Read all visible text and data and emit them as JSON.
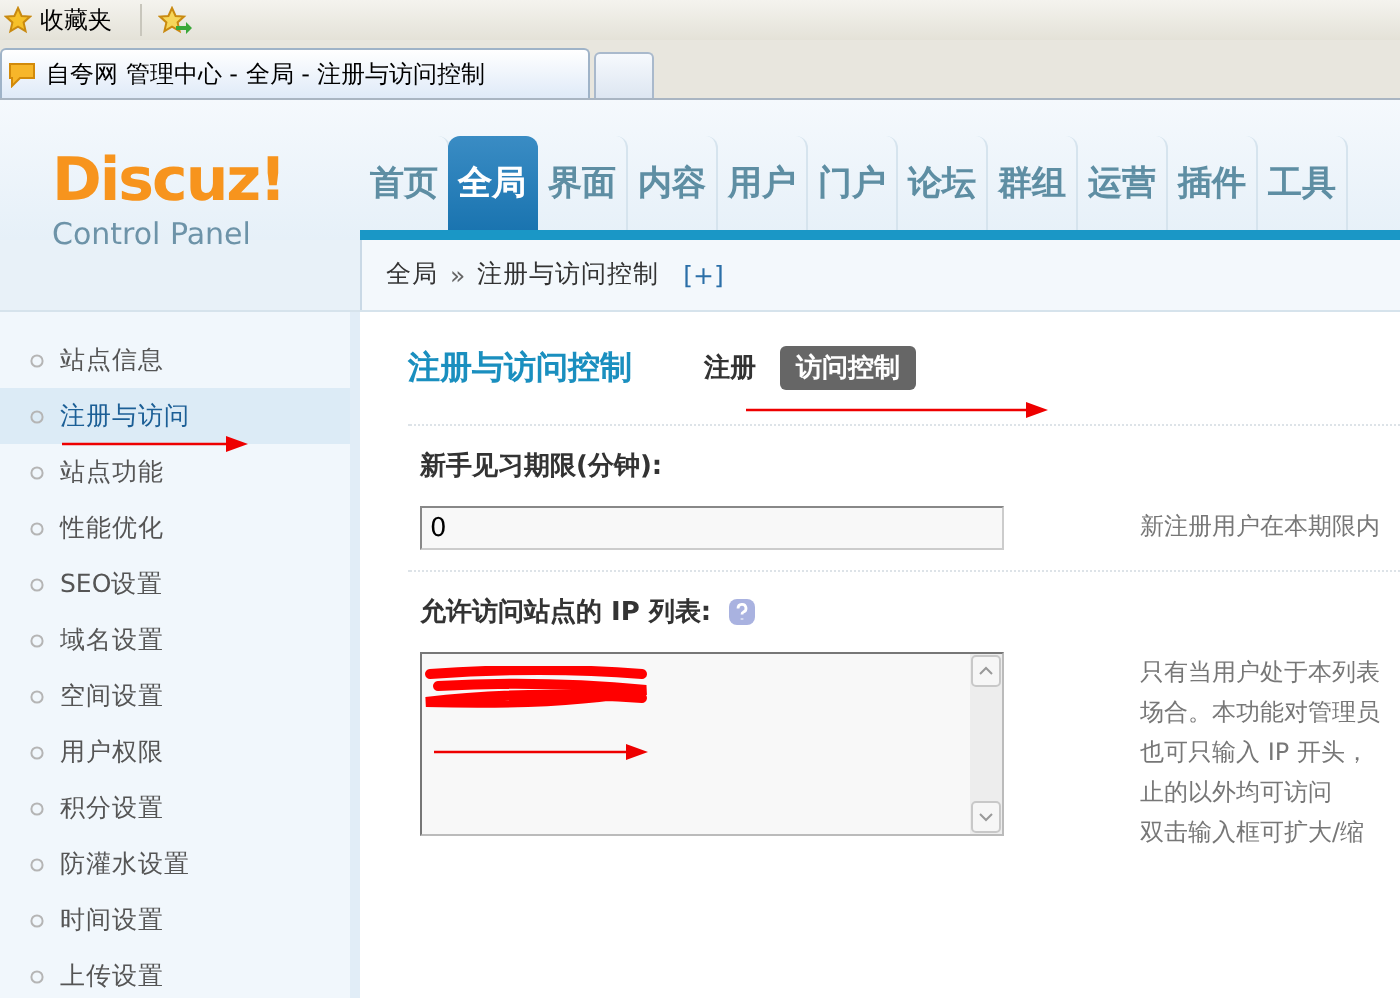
{
  "browser": {
    "favorites_label": "收藏夹",
    "tab_title": "自夸网 管理中心 - 全局 - 注册与访问控制"
  },
  "logo": {
    "name": "Discuz!",
    "subtitle": "Control Panel"
  },
  "nav": [
    {
      "label": "首页",
      "selected": false
    },
    {
      "label": "全局",
      "selected": true
    },
    {
      "label": "界面",
      "selected": false
    },
    {
      "label": "内容",
      "selected": false
    },
    {
      "label": "用户",
      "selected": false
    },
    {
      "label": "门户",
      "selected": false
    },
    {
      "label": "论坛",
      "selected": false
    },
    {
      "label": "群组",
      "selected": false
    },
    {
      "label": "运营",
      "selected": false
    },
    {
      "label": "插件",
      "selected": false
    },
    {
      "label": "工具",
      "selected": false
    }
  ],
  "breadcrumb": {
    "root": "全局",
    "separator": "»",
    "current": "注册与访问控制",
    "toggle": "[+]"
  },
  "sidebar": {
    "items": [
      {
        "label": "站点信息",
        "selected": false
      },
      {
        "label": "注册与访问",
        "selected": true
      },
      {
        "label": "站点功能",
        "selected": false
      },
      {
        "label": "性能优化",
        "selected": false
      },
      {
        "label": "SEO设置",
        "selected": false
      },
      {
        "label": "域名设置",
        "selected": false
      },
      {
        "label": "空间设置",
        "selected": false
      },
      {
        "label": "用户权限",
        "selected": false
      },
      {
        "label": "积分设置",
        "selected": false
      },
      {
        "label": "防灌水设置",
        "selected": false
      },
      {
        "label": "时间设置",
        "selected": false
      },
      {
        "label": "上传设置",
        "selected": false
      }
    ]
  },
  "page": {
    "title": "注册与访问控制",
    "subtabs": [
      {
        "label": "注册",
        "selected": false
      },
      {
        "label": "访问控制",
        "selected": true
      }
    ]
  },
  "settings": [
    {
      "kind": "input",
      "label": "新手见习期限(分钟):",
      "value": "0",
      "hint_lines": [
        "新注册用户在本期限内"
      ]
    },
    {
      "kind": "textarea",
      "label": "允许访问站点的 IP 列表:",
      "help": true,
      "redacted": true,
      "hint_lines": [
        "只有当用户处于本列表",
        "场合。本功能对管理员",
        "也可只输入 IP 开头，",
        "止的以外均可访问",
        "双击输入框可扩大/缩"
      ]
    }
  ]
}
